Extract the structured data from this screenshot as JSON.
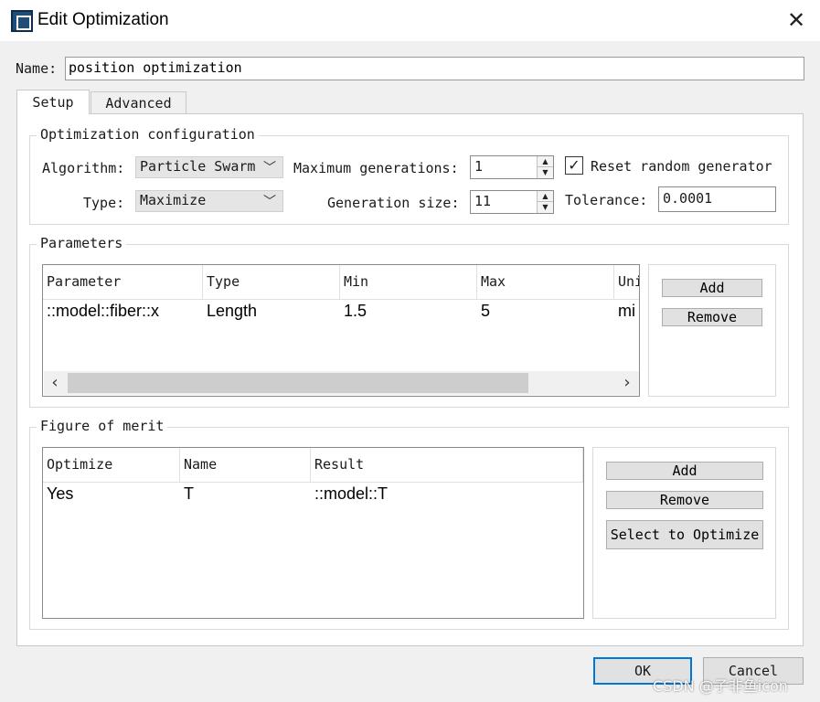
{
  "window": {
    "title": "Edit Optimization",
    "icon": "app-window-icon",
    "close_icon": "close-icon"
  },
  "name_field": {
    "label": "Name:",
    "value": "position optimization"
  },
  "tabs": [
    {
      "label": "Setup",
      "selected": true
    },
    {
      "label": "Advanced",
      "selected": false
    }
  ],
  "config": {
    "title": "Optimization configuration",
    "algorithm_label": "Algorithm:",
    "algorithm_value": "Particle Swarm",
    "type_label": "Type:",
    "type_value": "Maximize",
    "max_gen_label": "Maximum generations:",
    "max_gen_value": "1",
    "gen_size_label": "Generation size:",
    "gen_size_value": "11",
    "reset_label": "Reset random generator",
    "reset_checked": true,
    "tolerance_label": "Tolerance:",
    "tolerance_value": "0.0001"
  },
  "parameters": {
    "title": "Parameters",
    "columns": [
      "Parameter",
      "Type",
      "Min",
      "Max",
      "Uni"
    ],
    "rows": [
      [
        "::model::fiber::x",
        "Length",
        "1.5",
        "5",
        "mi"
      ]
    ],
    "add_label": "Add",
    "remove_label": "Remove"
  },
  "figure_of_merit": {
    "title": "Figure of merit",
    "columns": [
      "Optimize",
      "Name",
      "Result"
    ],
    "rows": [
      [
        "Yes",
        "T",
        "::model::T"
      ]
    ],
    "add_label": "Add",
    "remove_label": "Remove",
    "select_label": "Select to Optimize"
  },
  "footer": {
    "ok_label": "OK",
    "cancel_label": "Cancel",
    "watermark": "CSDN @子非鱼icon"
  },
  "colors": {
    "accent": "#0078d7",
    "title_bar": "#ffffff",
    "dialog_bg": "#f0f0f0"
  }
}
